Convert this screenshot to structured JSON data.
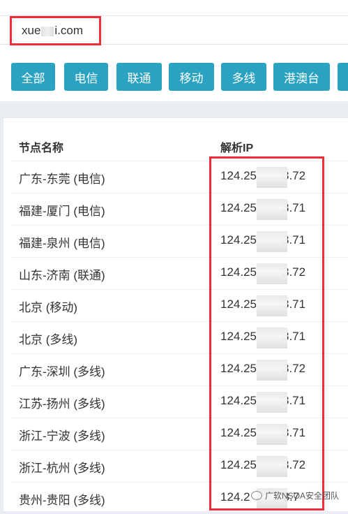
{
  "search": {
    "domain_prefix": "xue",
    "domain_suffix": "i.com"
  },
  "filters": [
    {
      "label": "全部"
    },
    {
      "label": "电信"
    },
    {
      "label": "联通"
    },
    {
      "label": "移动"
    },
    {
      "label": "多线"
    },
    {
      "label": "港澳台"
    }
  ],
  "table": {
    "columns": [
      "节点名称",
      "解析IP"
    ],
    "rows": [
      {
        "name": "广东-东莞 (电信)",
        "ip_prefix": "124.25",
        "ip_suffix": "3.72"
      },
      {
        "name": "福建-厦门 (电信)",
        "ip_prefix": "124.25",
        "ip_suffix": "3.71"
      },
      {
        "name": "福建-泉州 (电信)",
        "ip_prefix": "124.25",
        "ip_suffix": "3.71"
      },
      {
        "name": "山东-济南 (联通)",
        "ip_prefix": "124.25",
        "ip_suffix": "3.72"
      },
      {
        "name": "北京 (移动)",
        "ip_prefix": "124.25",
        "ip_suffix": "3.71"
      },
      {
        "name": "北京 (多线)",
        "ip_prefix": "124.25",
        "ip_suffix": "3.71"
      },
      {
        "name": "广东-深圳 (多线)",
        "ip_prefix": "124.25",
        "ip_suffix": "3.72"
      },
      {
        "name": "江苏-扬州 (多线)",
        "ip_prefix": "124.25",
        "ip_suffix": "3.71"
      },
      {
        "name": "浙江-宁波 (多线)",
        "ip_prefix": "124.25",
        "ip_suffix": "3.71"
      },
      {
        "name": "浙江-杭州 (多线)",
        "ip_prefix": "124.25",
        "ip_suffix": "3.72"
      },
      {
        "name": "贵州-贵阳 (多线)",
        "ip_prefix": "124.2",
        "ip_suffix": "3.7"
      }
    ]
  },
  "watermark": {
    "text": "广软NSOA安全团队"
  },
  "colors": {
    "button": "#2aa3c3",
    "highlight": "#ee2b36",
    "background": "#e9ecf1"
  }
}
